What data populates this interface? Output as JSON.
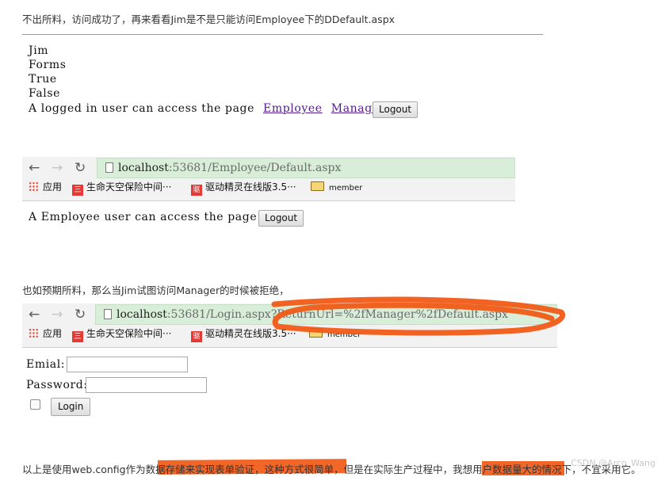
{
  "intro_text_1": "不出所料，访问成功了，再来看看Jim是不是只能访问Employee下的DDefault.aspx",
  "panel1": {
    "lines": [
      "Jim",
      "Forms",
      "True",
      "False"
    ],
    "access_text": "A logged in user can access the page",
    "link_employee": "Employee",
    "link_manager": "Manager",
    "logout_label": "Logout"
  },
  "browser1": {
    "url_host": "localhost",
    "url_rest": ":53681/Employee/Default.aspx",
    "bookmarks": {
      "apps": "应用",
      "bm1": "生命天空保险中间···",
      "bm2": "驱动精灵在线版3.5···",
      "bm3": "member"
    }
  },
  "panel2": {
    "access_text": "A Employee user can access the page",
    "logout_label": "Logout"
  },
  "intro_text_2": "也如预期所料，那么当Jim试图访问Manager的时候被拒绝，",
  "browser2": {
    "url_host": "localhost",
    "url_rest": ":53681/Login.aspx?ReturnUrl=%2fManager%2fDefault.aspx",
    "bookmarks": {
      "apps": "应用",
      "bm1": "生命天空保险中间···",
      "bm2": "驱动精灵在线版3.5···",
      "bm3": "member"
    }
  },
  "login_form": {
    "email_label": "Emial:",
    "password_label": "Password:",
    "login_label": "Login",
    "email_value": "",
    "password_value": ""
  },
  "bottom_text": "以上是使用web.config作为数据存储来实现表单验证，这种方式很简单，但是在实际生产过程中，我想用户数据量大的情况下，不宜采用它。",
  "watermark": "CSDN @Arco_Wang",
  "colors": {
    "highlight": "#f15a16",
    "urlbar": "#d9eed9",
    "link": "#551a8b"
  }
}
